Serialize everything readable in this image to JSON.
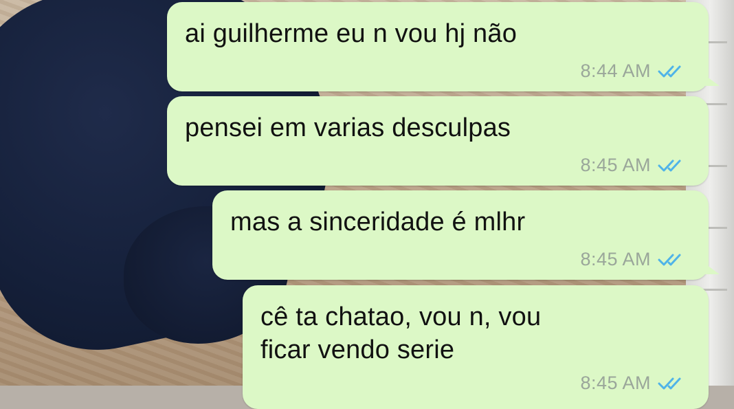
{
  "colors": {
    "bubble_bg": "#dcf8c6",
    "text": "#111111",
    "time": "#9aa69a",
    "read_ticks": "#4fb3e8"
  },
  "messages": [
    {
      "text": "ai guilherme eu n vou hj não",
      "time": "8:44 AM",
      "status_icon": "double-check-read-icon"
    },
    {
      "text": "pensei em varias desculpas",
      "time": "8:45 AM",
      "status_icon": "double-check-read-icon"
    },
    {
      "text": "mas a sinceridade é mlhr",
      "time": "8:45 AM",
      "status_icon": "double-check-read-icon"
    },
    {
      "text": "cê ta chatao, vou n, vou\nficar vendo serie",
      "time": "8:45 AM",
      "status_icon": "double-check-read-icon"
    }
  ]
}
